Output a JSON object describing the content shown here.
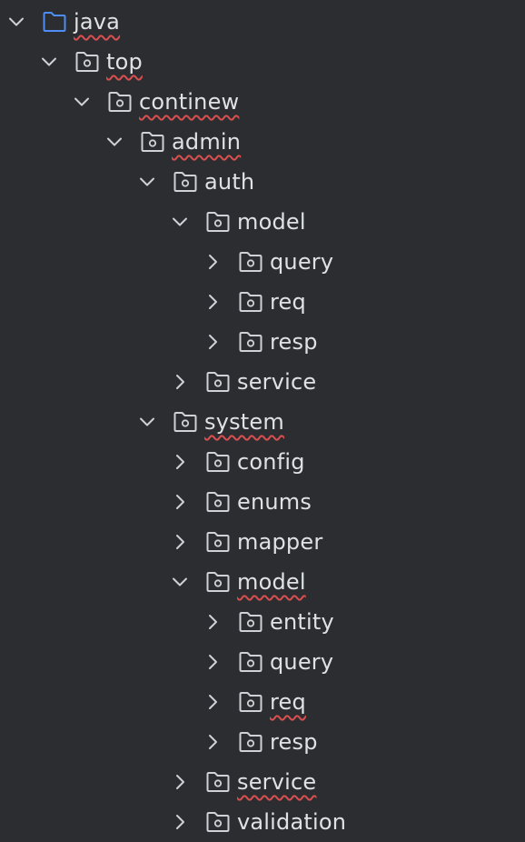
{
  "colors": {
    "background": "#2b2d30",
    "text": "#dfe1e5",
    "folder_default": "#cfd1d6",
    "folder_source": "#4d8df5",
    "chevron": "#cfd1d6",
    "typo_underline": "#d94f4f"
  },
  "tree": [
    {
      "label": "java",
      "depth": 0,
      "expanded": true,
      "icon": "source-folder-icon",
      "typo": true
    },
    {
      "label": "top",
      "depth": 1,
      "expanded": true,
      "icon": "package-icon",
      "typo": true
    },
    {
      "label": "continew",
      "depth": 2,
      "expanded": true,
      "icon": "package-icon",
      "typo": true
    },
    {
      "label": "admin",
      "depth": 3,
      "expanded": true,
      "icon": "package-icon",
      "typo": true
    },
    {
      "label": "auth",
      "depth": 4,
      "expanded": true,
      "icon": "package-icon",
      "typo": false
    },
    {
      "label": "model",
      "depth": 5,
      "expanded": true,
      "icon": "package-icon",
      "typo": false
    },
    {
      "label": "query",
      "depth": 6,
      "expanded": false,
      "icon": "package-icon",
      "typo": false
    },
    {
      "label": "req",
      "depth": 6,
      "expanded": false,
      "icon": "package-icon",
      "typo": false
    },
    {
      "label": "resp",
      "depth": 6,
      "expanded": false,
      "icon": "package-icon",
      "typo": false
    },
    {
      "label": "service",
      "depth": 5,
      "expanded": false,
      "icon": "package-icon",
      "typo": false
    },
    {
      "label": "system",
      "depth": 4,
      "expanded": true,
      "icon": "package-icon",
      "typo": true
    },
    {
      "label": "config",
      "depth": 5,
      "expanded": false,
      "icon": "package-icon",
      "typo": false
    },
    {
      "label": "enums",
      "depth": 5,
      "expanded": false,
      "icon": "package-icon",
      "typo": false
    },
    {
      "label": "mapper",
      "depth": 5,
      "expanded": false,
      "icon": "package-icon",
      "typo": false
    },
    {
      "label": "model",
      "depth": 5,
      "expanded": true,
      "icon": "package-icon",
      "typo": true
    },
    {
      "label": "entity",
      "depth": 6,
      "expanded": false,
      "icon": "package-icon",
      "typo": false
    },
    {
      "label": "query",
      "depth": 6,
      "expanded": false,
      "icon": "package-icon",
      "typo": false
    },
    {
      "label": "req",
      "depth": 6,
      "expanded": false,
      "icon": "package-icon",
      "typo": true
    },
    {
      "label": "resp",
      "depth": 6,
      "expanded": false,
      "icon": "package-icon",
      "typo": false
    },
    {
      "label": "service",
      "depth": 5,
      "expanded": false,
      "icon": "package-icon",
      "typo": true
    },
    {
      "label": "validation",
      "depth": 5,
      "expanded": false,
      "icon": "package-icon",
      "typo": false
    }
  ]
}
